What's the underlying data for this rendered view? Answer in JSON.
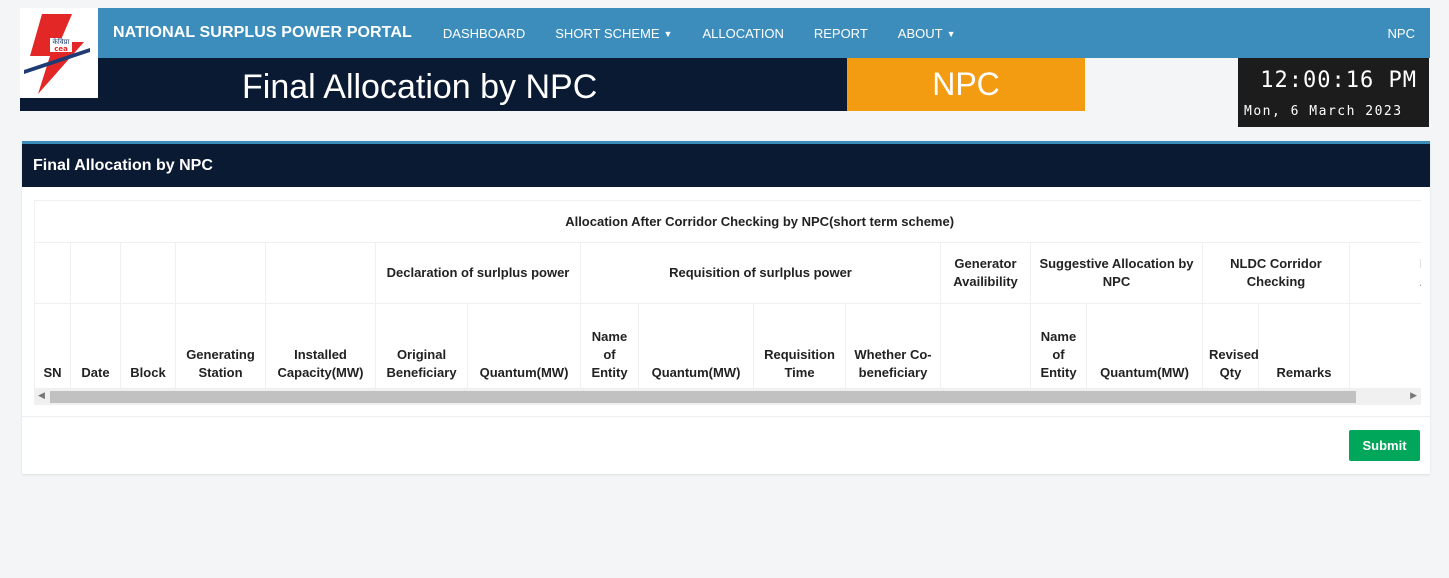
{
  "nav": {
    "brand": "NATIONAL SURPLUS POWER PORTAL",
    "items": [
      {
        "label": "DASHBOARD",
        "caret": false
      },
      {
        "label": "SHORT SCHEME",
        "caret": true
      },
      {
        "label": "ALLOCATION",
        "caret": false
      },
      {
        "label": "REPORT",
        "caret": false
      },
      {
        "label": "ABOUT",
        "caret": true
      }
    ],
    "user": "NPC"
  },
  "logo": {
    "text": "केविप्रा",
    "abbr": "cea"
  },
  "banner": {
    "title": "Final Allocation by NPC",
    "role": "NPC"
  },
  "clock": {
    "time": "12:00:16 PM",
    "date": "Mon, 6 March 2023"
  },
  "panel": {
    "title": "Final Allocation by NPC",
    "table_caption": "Allocation After Corridor Checking by NPC(short term scheme)",
    "group_headers": [
      "Declaration of surlplus power",
      "Requisition of surlplus power",
      "Generator Availibility",
      "Suggestive Allocation by NPC",
      "NLDC Corridor Checking",
      "Final Allocation"
    ],
    "columns": [
      "SN",
      "Date",
      "Block",
      "Generating Station",
      "Installed Capacity(MW)",
      "Original Beneficiary",
      "Quantum(MW)",
      "Name of Entity",
      "Quantum(MW)",
      "Requisition Time",
      "Whether Co-beneficiary",
      "",
      "Name of Entity",
      "Quantum(MW)",
      "Revised Qty",
      "Remarks",
      ""
    ],
    "submit_label": "Submit"
  },
  "colors": {
    "nav_bg": "#3c8dbc",
    "banner_bg": "#0b1a33",
    "role_bg": "#f39c12",
    "submit_bg": "#00a65a"
  }
}
